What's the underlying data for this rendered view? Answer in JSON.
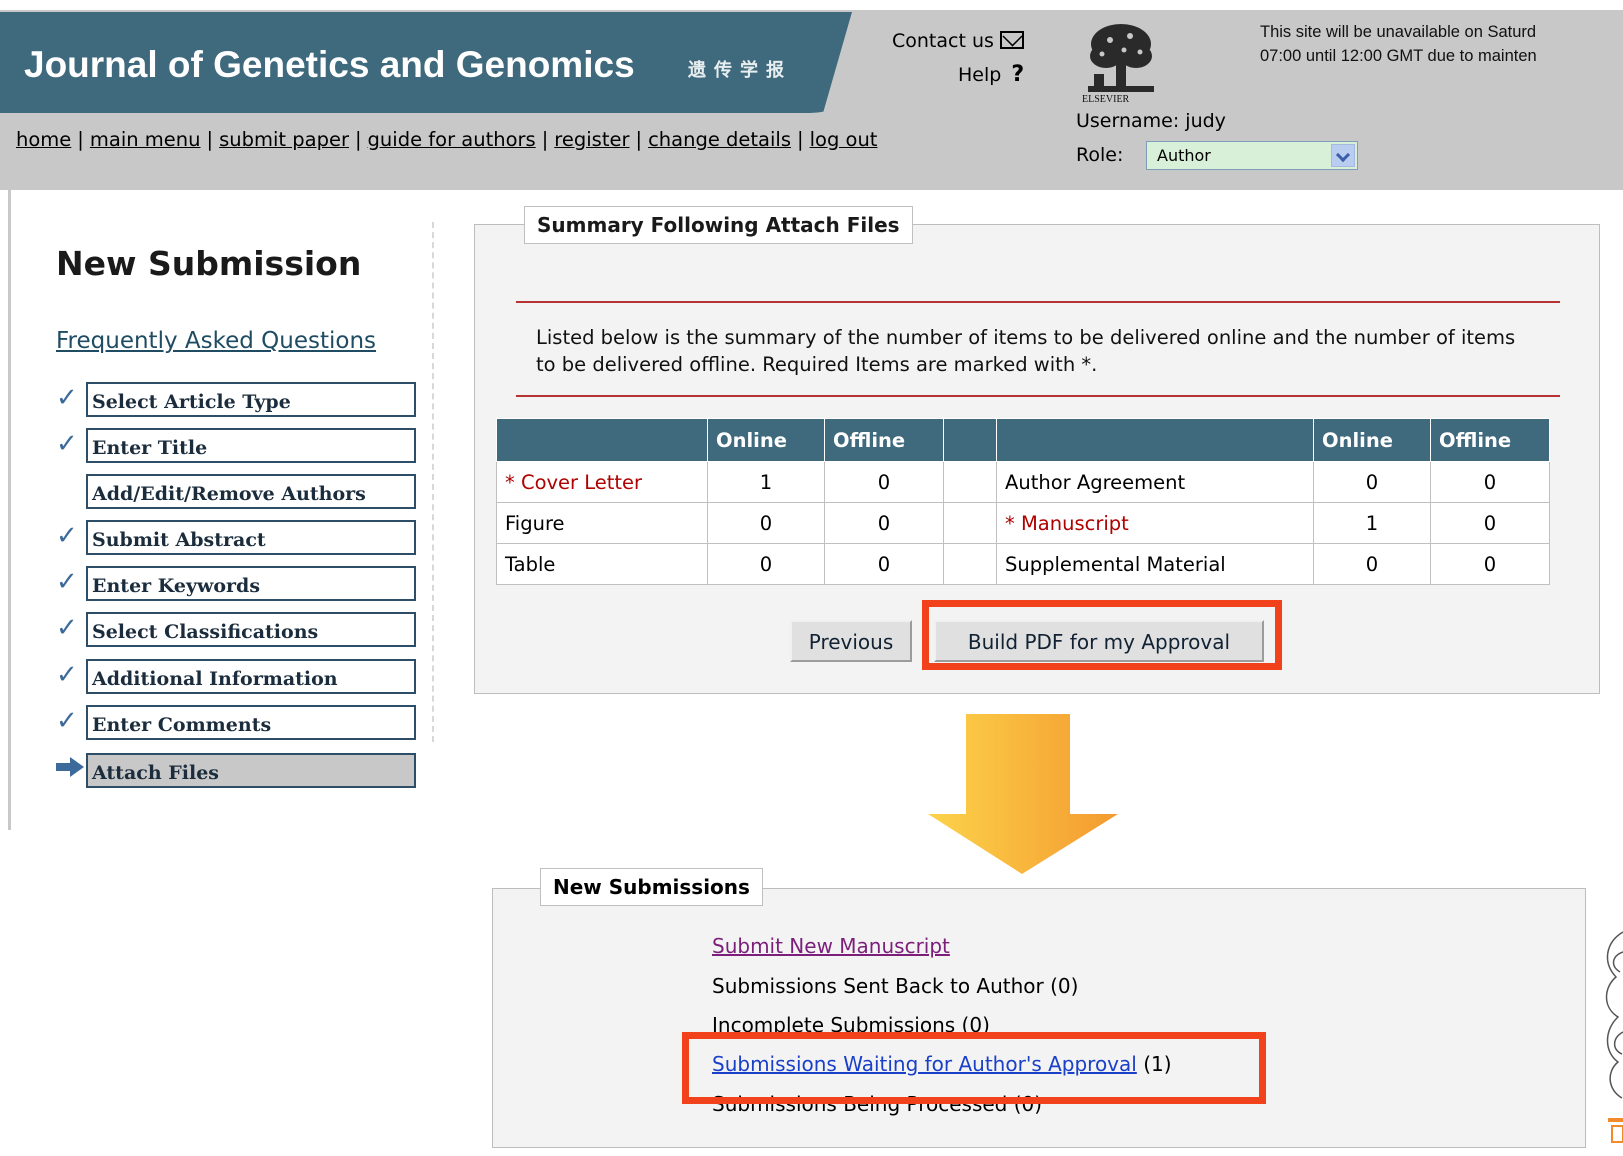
{
  "header": {
    "journal_title": "Journal of Genetics and Genomics",
    "journal_chinese": "遗传学报",
    "contact_label": "Contact us",
    "help_label": "Help",
    "publisher_logo_text": "ELSEVIER",
    "maintenance_line1": "This site will be unavailable on Saturd",
    "maintenance_line2": "07:00 until 12:00 GMT due to mainten",
    "username_line": "Username: judy",
    "role_label": "Role:",
    "role_value": "Author"
  },
  "nav": {
    "home": "home",
    "main_menu": "main menu",
    "submit_paper": "submit paper",
    "guide_for_authors": "guide for authors",
    "register": "register",
    "change_details": "change details",
    "log_out": "log out",
    "separator": "|"
  },
  "sidebar": {
    "title": "New Submission",
    "faq_link": "Frequently Asked Questions",
    "steps": [
      {
        "label": "Select Article Type",
        "status": "done"
      },
      {
        "label": "Enter Title",
        "status": "done"
      },
      {
        "label": "Add/Edit/Remove Authors",
        "status": "none"
      },
      {
        "label": "Submit Abstract",
        "status": "done"
      },
      {
        "label": "Enter Keywords",
        "status": "done"
      },
      {
        "label": "Select Classifications",
        "status": "done"
      },
      {
        "label": "Additional Information",
        "status": "done"
      },
      {
        "label": "Enter Comments",
        "status": "done"
      },
      {
        "label": "Attach Files",
        "status": "current"
      }
    ]
  },
  "summary": {
    "legend": "Summary Following Attach Files",
    "description": "Listed below is the summary of the number of items to be delivered online and the number of items to be delivered offline. Required Items are marked with *.",
    "headers": [
      "",
      "Online",
      "Offline",
      "",
      "",
      "Online",
      "Offline"
    ],
    "rows": [
      {
        "left_name": "* Cover Letter",
        "left_required": true,
        "left_online": "1",
        "left_offline": "0",
        "right_name": "Author Agreement",
        "right_required": false,
        "right_online": "0",
        "right_offline": "0"
      },
      {
        "left_name": "Figure",
        "left_required": false,
        "left_online": "0",
        "left_offline": "0",
        "right_name": "* Manuscript",
        "right_required": true,
        "right_online": "1",
        "right_offline": "0"
      },
      {
        "left_name": "Table",
        "left_required": false,
        "left_online": "0",
        "left_offline": "0",
        "right_name": "Supplemental Material",
        "right_required": false,
        "right_online": "0",
        "right_offline": "0"
      }
    ],
    "previous_button": "Previous",
    "build_button": "Build PDF for my Approval"
  },
  "new_submissions": {
    "legend": "New Submissions",
    "submit_new": "Submit New Manuscript",
    "sent_back": "Submissions Sent Back to Author (0)",
    "incomplete": "Incomplete Submissions (0)",
    "waiting_link": "Submissions Waiting for Author's Approval",
    "waiting_count": "(1)",
    "processed": "Submissions Being Processed (0)"
  },
  "colors": {
    "header_band": "#3f6a7d",
    "highlight": "#f2421b",
    "arrow": "#f7a83a",
    "required": "#b00000"
  }
}
